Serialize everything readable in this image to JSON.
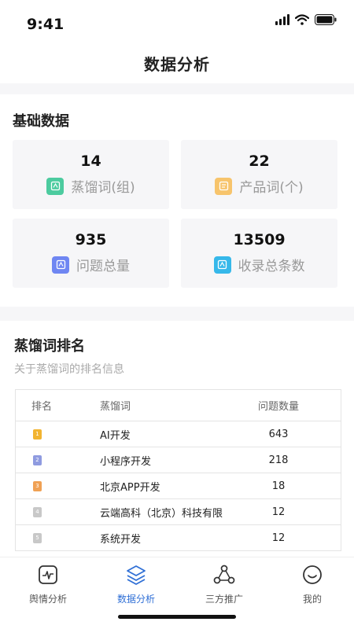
{
  "status_bar": {
    "time": "9:41"
  },
  "nav": {
    "title": "数据分析"
  },
  "basic": {
    "title": "基础数据",
    "cards": [
      {
        "value": "14",
        "label": "蒸馏词(组)",
        "icon": "tag-icon",
        "color": "#4ccb9f"
      },
      {
        "value": "22",
        "label": "产品词(个)",
        "icon": "box-icon",
        "color": "#f7c46c"
      },
      {
        "value": "935",
        "label": "问题总量",
        "icon": "question-icon",
        "color": "#6f86f2"
      },
      {
        "value": "13509",
        "label": "收录总条数",
        "icon": "collection-icon",
        "color": "#36b8ea"
      }
    ]
  },
  "ranking": {
    "title": "蒸馏词排名",
    "subtitle": "关于蒸馏词的排名信息",
    "columns": [
      "排名",
      "蒸馏词",
      "问题数量"
    ],
    "rows": [
      {
        "rank": "1",
        "word": "AI开发",
        "count": "643",
        "medal_color": "#f2b431"
      },
      {
        "rank": "2",
        "word": "小程序开发",
        "count": "218",
        "medal_color": "#8f9be0"
      },
      {
        "rank": "3",
        "word": "北京APP开发",
        "count": "18",
        "medal_color": "#f0a154"
      },
      {
        "rank": "4",
        "word": "云端高科（北京）科技有限",
        "count": "12",
        "medal_color": "#c8c8c8"
      },
      {
        "rank": "5",
        "word": "系统开发",
        "count": "12",
        "medal_color": "#c8c8c8"
      }
    ]
  },
  "tabs": [
    {
      "label": "舆情分析",
      "icon": "pulse-monitor-icon"
    },
    {
      "label": "数据分析",
      "icon": "layers-icon",
      "active": true
    },
    {
      "label": "三方推广",
      "icon": "network-icon"
    },
    {
      "label": "我的",
      "icon": "smiley-icon"
    }
  ],
  "colors": {
    "accent": "#2f6fd6"
  }
}
